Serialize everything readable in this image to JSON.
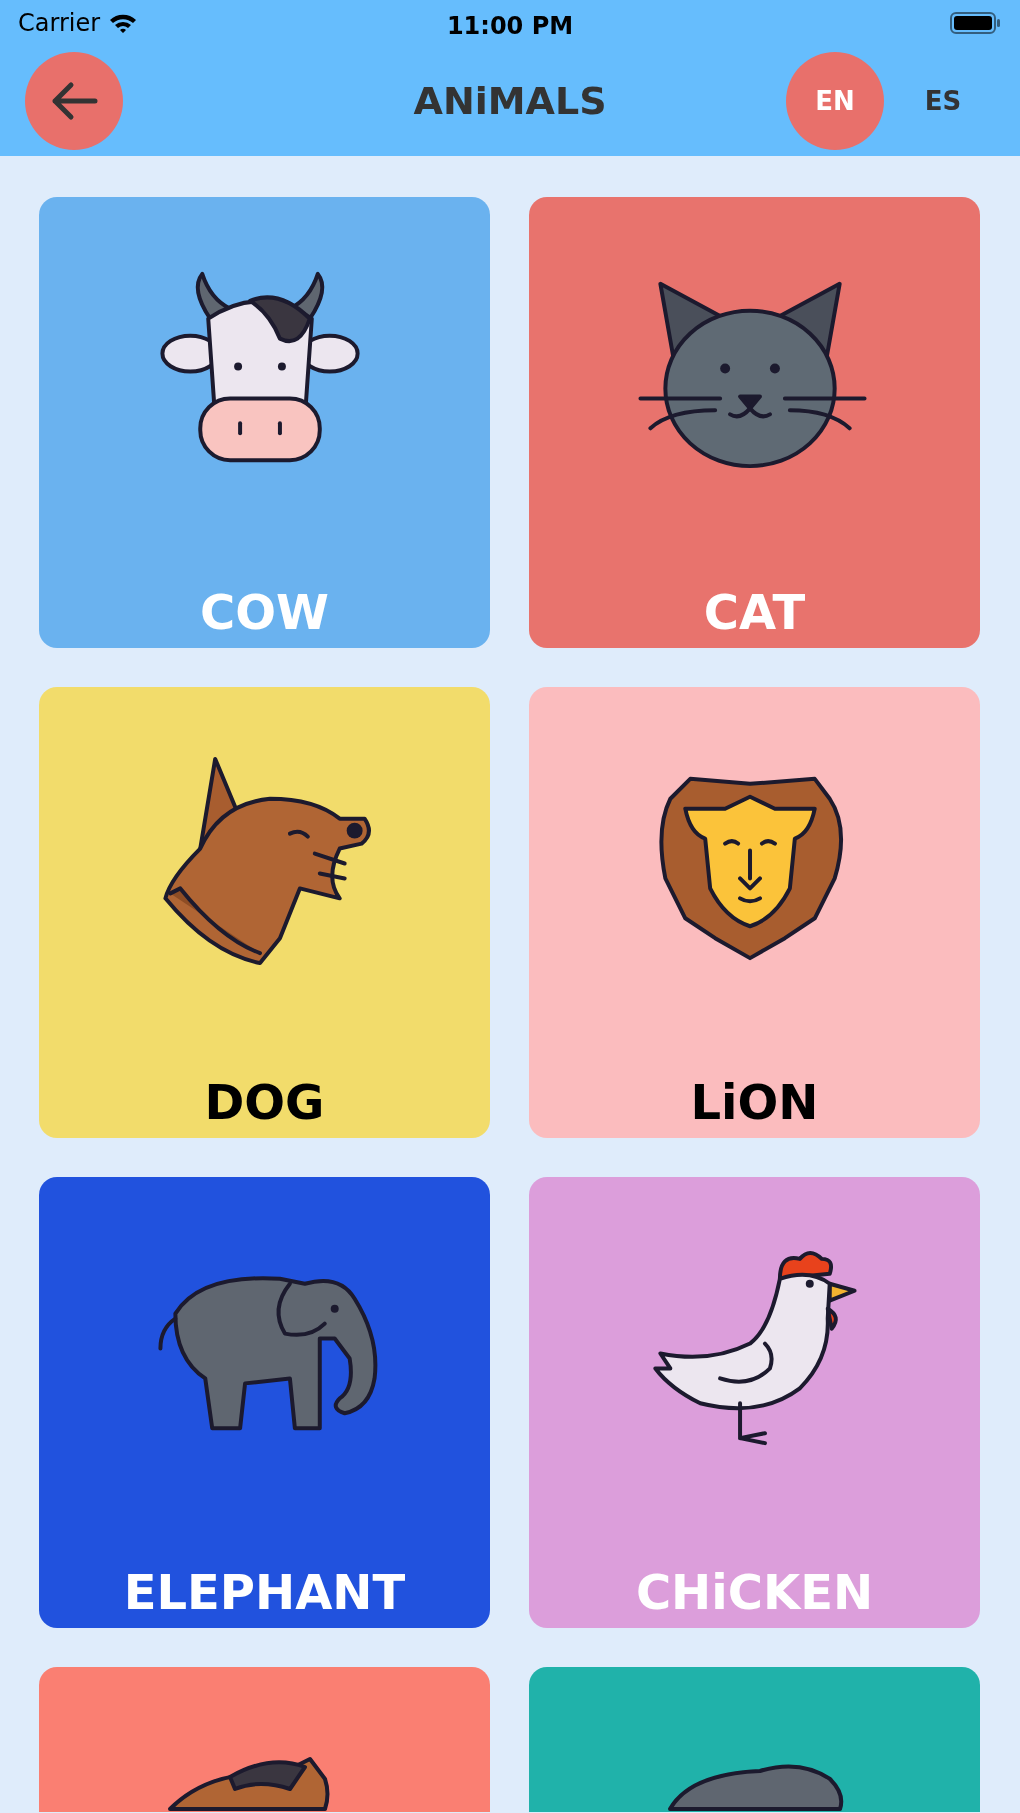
{
  "status_bar": {
    "carrier": "Carrier",
    "time": "11:00 PM"
  },
  "header": {
    "title": "ANiMALS",
    "languages": [
      {
        "label": "EN",
        "selected": true
      },
      {
        "label": "ES",
        "selected": false
      }
    ]
  },
  "cards": [
    {
      "kind": "cow",
      "label": "COW",
      "color": "#6ab2ef",
      "label_dark": false
    },
    {
      "kind": "cat",
      "label": "CAT",
      "color": "#e8736d",
      "label_dark": false
    },
    {
      "kind": "dog",
      "label": "DOG",
      "color": "#f2dc6b",
      "label_dark": true
    },
    {
      "kind": "lion",
      "label": "LiON",
      "color": "#fbbcbe",
      "label_dark": true
    },
    {
      "kind": "elephant",
      "label": "ELEPHANT",
      "color": "#2152de",
      "label_dark": false
    },
    {
      "kind": "chicken",
      "label": "CHiCKEN",
      "color": "#dc9edb",
      "label_dark": false
    },
    {
      "kind": "horse",
      "color": "#fa7f72"
    },
    {
      "kind": "gorilla",
      "color": "#20b2aa"
    }
  ]
}
